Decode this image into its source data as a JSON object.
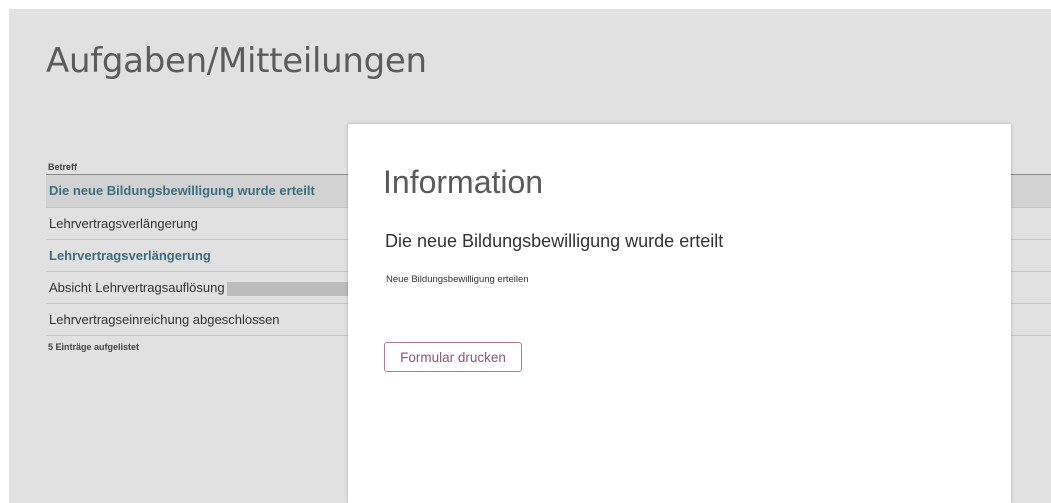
{
  "page": {
    "title": "Aufgaben/Mitteilungen"
  },
  "table": {
    "column_header": "Betreff",
    "rows": [
      {
        "subject": "Die neue Bildungsbewilligung wurde erteilt",
        "unread": true,
        "selected": true
      },
      {
        "subject": "Lehrvertragsverlängerung",
        "unread": false,
        "selected": false
      },
      {
        "subject": "Lehrvertragsverlängerung",
        "unread": true,
        "selected": false
      },
      {
        "subject": "Absicht Lehrvertragsauflösung",
        "unread": false,
        "selected": false,
        "redacted_suffix": true
      },
      {
        "subject": "Lehrvertragseinreichung abgeschlossen",
        "unread": false,
        "selected": false
      }
    ],
    "footer_count": "5 Einträge aufgelistet"
  },
  "modal": {
    "title": "Information",
    "subtitle": "Die neue Bildungsbewilligung wurde erteilt",
    "description": "Neue Bildungsbewilligung erteilen",
    "print_button_label": "Formular drucken"
  },
  "colors": {
    "unread_text": "#3f6d80",
    "button_border": "#b07a92",
    "button_text": "#8c5a73",
    "background": "#e1e1e1"
  }
}
